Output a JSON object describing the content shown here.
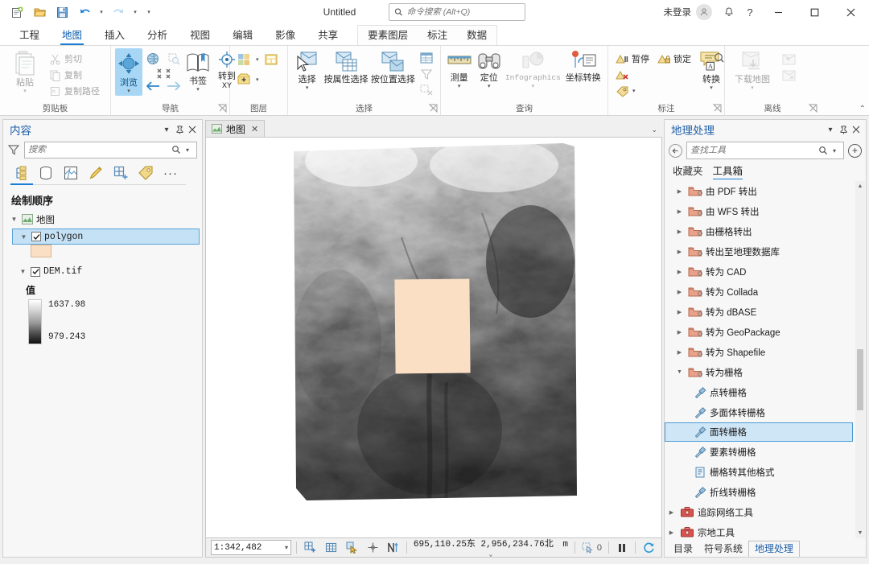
{
  "titlebar": {
    "qat": [
      {
        "name": "new-project-icon",
        "title": "新建"
      },
      {
        "name": "open-project-icon",
        "title": "打开"
      },
      {
        "name": "save-project-icon",
        "title": "保存"
      },
      {
        "name": "undo-icon",
        "title": "撤销"
      },
      {
        "name": "redo-icon",
        "title": "恢复"
      },
      {
        "name": "customize-qat-icon",
        "title": "自定义快速访问工具栏"
      }
    ],
    "project_title": "Untitled",
    "command_search_placeholder": "命令搜索 (Alt+Q)",
    "sign_in_label": "未登录",
    "help_label": "?",
    "minimize_label": "─",
    "maximize_label": "☐",
    "close_label": "✕"
  },
  "ribbon": {
    "tabs": [
      {
        "label": "工程",
        "active": false
      },
      {
        "label": "地图",
        "active": true
      },
      {
        "label": "插入",
        "active": false
      },
      {
        "label": "分析",
        "active": false
      },
      {
        "label": "视图",
        "active": false
      },
      {
        "label": "编辑",
        "active": false
      },
      {
        "label": "影像",
        "active": false
      },
      {
        "label": "共享",
        "active": false
      }
    ],
    "contextual_tabs": [
      {
        "label": "要素图层"
      },
      {
        "label": "标注"
      },
      {
        "label": "数据"
      }
    ],
    "groups": {
      "clipboard": {
        "label": "剪贴板",
        "paste": "粘贴",
        "cut": "剪切",
        "copy": "复制",
        "copy_path": "复制路径"
      },
      "navigate": {
        "label": "导航",
        "explore": "浏览",
        "bookmarks": "书签",
        "goto_xy": "转到\nXY",
        "goto_xy_line1": "转到",
        "goto_xy_line2": "XY"
      },
      "layer": {
        "label": "图层"
      },
      "selection": {
        "label": "选择",
        "select": "选择",
        "select_by_attributes": "按属性选择",
        "select_by_location": "按位置选择"
      },
      "inquiry": {
        "label": "查询",
        "measure": "测量",
        "locate": "定位",
        "infographics": "Infographics",
        "coordinate_conversion": "坐标转换"
      },
      "labeling": {
        "label": "标注",
        "pause": "暂停",
        "lock": "锁定",
        "convert": "转换"
      },
      "offline": {
        "label": "离线",
        "download_map": "下载地图"
      }
    },
    "collapse_label": "⌃"
  },
  "contents_pane": {
    "title": "内容",
    "search_placeholder": "搜索",
    "toolbar_icons": [
      {
        "name": "list-by-drawing-order-icon",
        "active": true
      },
      {
        "name": "list-by-data-source-icon",
        "active": false
      },
      {
        "name": "list-by-selection-icon",
        "active": false
      },
      {
        "name": "list-by-editing-icon",
        "active": false
      },
      {
        "name": "list-by-snapping-icon",
        "active": false
      },
      {
        "name": "list-by-labeling-icon",
        "active": false
      },
      {
        "name": "more-options-icon",
        "active": false
      }
    ],
    "section_title": "绘制顺序",
    "tree": {
      "map_node": "地图",
      "layers": [
        {
          "label": "polygon",
          "checked": true,
          "selected": true,
          "swatch_color": "#fadfc5"
        },
        {
          "label": "DEM.tif",
          "checked": true,
          "selected": false
        }
      ],
      "raster_legend": {
        "header": "值",
        "max": "1637.98",
        "min": "979.243"
      }
    }
  },
  "map_view": {
    "tab_label": "地图",
    "tab_close": "✕",
    "tabs_caret": "⌄",
    "layers": {
      "raster_name": "DEM.tif",
      "polygon_fill": "#fadfc5"
    }
  },
  "map_status": {
    "scale": "1:342,482",
    "scale_caret": "▾",
    "tools": [
      {
        "name": "add-grid-icon"
      },
      {
        "name": "grid-icon"
      },
      {
        "name": "selection-tool-icon"
      },
      {
        "name": "crosshair-icon"
      },
      {
        "name": "north-arrow-icon"
      }
    ],
    "coordinates": "695,110.25东  2,956,234.76北",
    "coordinate_units": "m",
    "units_caret": "⌄",
    "selection_count": "0",
    "pause_label": "❙❙",
    "refresh_label": "↻"
  },
  "geoprocessing_pane": {
    "title": "地理处理",
    "search_placeholder": "查找工具",
    "back_label": "←",
    "add_label": "+",
    "tabs": [
      {
        "label": "收藏夹",
        "active": false
      },
      {
        "label": "工具箱",
        "active": true
      }
    ],
    "tree": [
      {
        "label": "由 PDF 转出",
        "type": "toolset",
        "expanded": false,
        "indent": 0,
        "mono_part": "PDF"
      },
      {
        "label": "由 WFS 转出",
        "type": "toolset",
        "expanded": false,
        "indent": 0,
        "mono_part": "WFS"
      },
      {
        "label": "由栅格转出",
        "type": "toolset",
        "expanded": false,
        "indent": 0
      },
      {
        "label": "转出至地理数据库",
        "type": "toolset",
        "expanded": false,
        "indent": 0
      },
      {
        "label": "转为 CAD",
        "type": "toolset",
        "expanded": false,
        "indent": 0
      },
      {
        "label": "转为 Collada",
        "type": "toolset",
        "expanded": false,
        "indent": 0
      },
      {
        "label": "转为 dBASE",
        "type": "toolset",
        "expanded": false,
        "indent": 0
      },
      {
        "label": "转为 GeoPackage",
        "type": "toolset",
        "expanded": false,
        "indent": 0
      },
      {
        "label": "转为 Shapefile",
        "type": "toolset",
        "expanded": false,
        "indent": 0
      },
      {
        "label": "转为栅格",
        "type": "toolset",
        "expanded": true,
        "indent": 0
      },
      {
        "label": "点转栅格",
        "type": "tool",
        "indent": 1
      },
      {
        "label": "多面体转栅格",
        "type": "tool",
        "indent": 1
      },
      {
        "label": "面转栅格",
        "type": "tool",
        "indent": 1,
        "selected": true
      },
      {
        "label": "要素转栅格",
        "type": "tool",
        "indent": 1
      },
      {
        "label": "栅格转其他格式",
        "type": "tool-alt",
        "indent": 1
      },
      {
        "label": "折线转栅格",
        "type": "tool",
        "indent": 1
      },
      {
        "label": "追踪网络工具",
        "type": "toolbox",
        "expanded": false,
        "indent": -1
      },
      {
        "label": "宗地工具",
        "type": "toolbox",
        "expanded": false,
        "indent": -1
      }
    ]
  },
  "dock_tabs": [
    {
      "label": "目录",
      "active": false
    },
    {
      "label": "符号系统",
      "active": false
    },
    {
      "label": "地理处理",
      "active": true
    }
  ],
  "colors": {
    "accent": "#1a7fd4",
    "pane_title": "#1f5fa8",
    "selection": "#c4e1f5",
    "polygon": "#fadfc5",
    "ribbon_selected": "#a8d7f5"
  }
}
